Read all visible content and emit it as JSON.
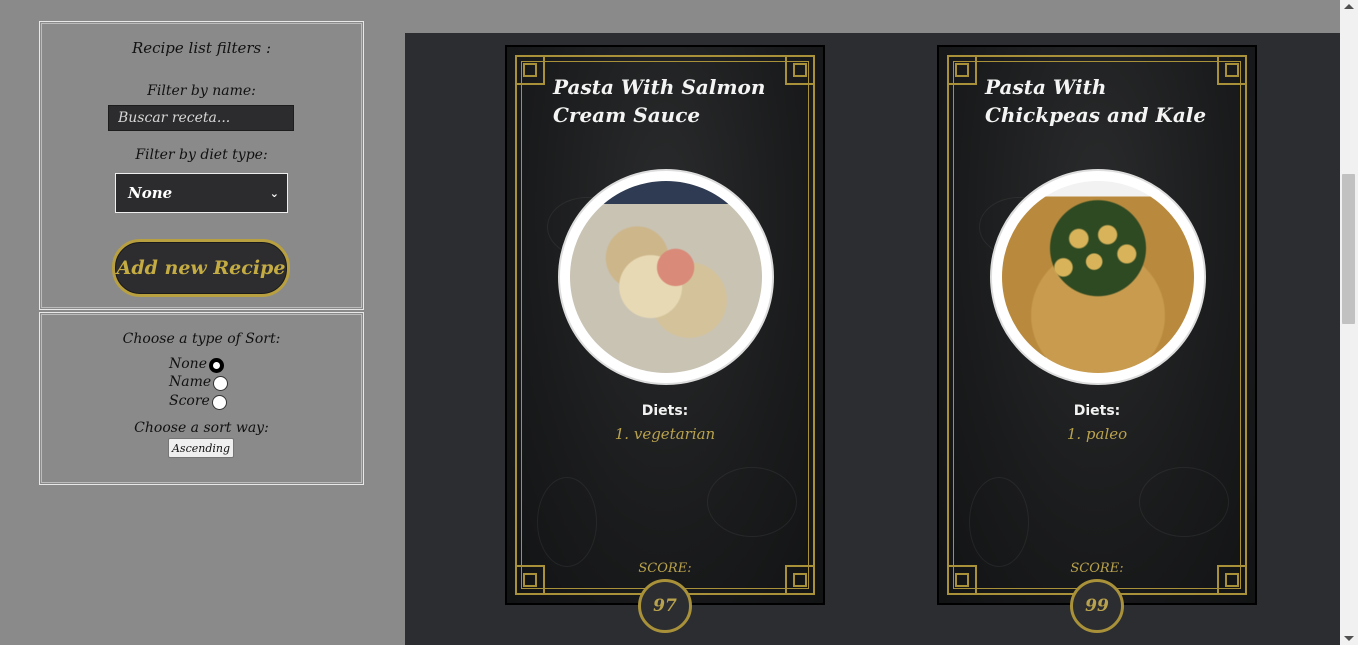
{
  "filters": {
    "title": "Recipe list filters :",
    "name_label": "Filter by name:",
    "name_placeholder": "Buscar receta...",
    "diet_label": "Filter by diet type:",
    "diet_selected": "None",
    "add_button": "Add new Recipe"
  },
  "sort": {
    "title": "Choose a type of Sort:",
    "options": [
      {
        "label": "None",
        "checked": true
      },
      {
        "label": "Name",
        "checked": false
      },
      {
        "label": "Score",
        "checked": false
      }
    ],
    "way_title": "Choose a sort way:",
    "way_button": "Ascending"
  },
  "cards": [
    {
      "title": "Pasta With Salmon Cream Sauce",
      "diets_label": "Diets:",
      "diets": [
        "1. vegetarian"
      ],
      "score_label": "SCORE:",
      "score": "97"
    },
    {
      "title": "Pasta With Chickpeas and Kale",
      "diets_label": "Diets:",
      "diets": [
        "1. paleo"
      ],
      "score_label": "SCORE:",
      "score": "99"
    }
  ],
  "colors": {
    "page_bg": "#8a8a8a",
    "cards_bg": "#2c2d30",
    "gold": "#b9a24d"
  }
}
